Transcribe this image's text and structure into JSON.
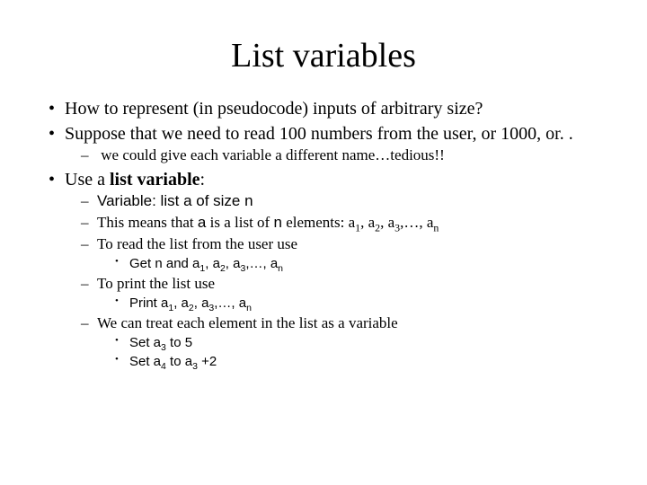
{
  "title": "List variables",
  "b1": "How to represent (in pseudocode) inputs of arbitrary size?",
  "b2": "Suppose that we need to read 100 numbers from the user, or 1000, or. .",
  "b2_1": "we could give each variable a different name…tedious!!",
  "b3_pre": "Use a ",
  "b3_bold": "list variable",
  "b3_post": ":",
  "b3_1_pre": "Variable: list ",
  "b3_1_a": "a",
  "b3_1_mid": " of size ",
  "b3_1_n": "n",
  "b3_2_p1": "This means that ",
  "b3_2_a": "a",
  "b3_2_p2": " is a list of ",
  "b3_2_n": "n",
  "b3_2_p3": " elements: a",
  "sub1": "1",
  "comma": ", a",
  "sub2": "2",
  "sub3": "3",
  "dots": ",…, a",
  "subn": "n",
  "b3_3": "To read the list from the user use",
  "b3_3_1_pre": "Get n and a",
  "b3_4": "To print the list use",
  "b3_4_1_pre": "Print a",
  "b3_5": "We can treat each element in the list as a variable",
  "b3_5_1_pre": "Set a",
  "b3_5_1_post": " to 5",
  "b3_5_2_pre": "Set a",
  "sub4": "4",
  "b3_5_2_mid": " to a",
  "b3_5_2_post": " +2"
}
